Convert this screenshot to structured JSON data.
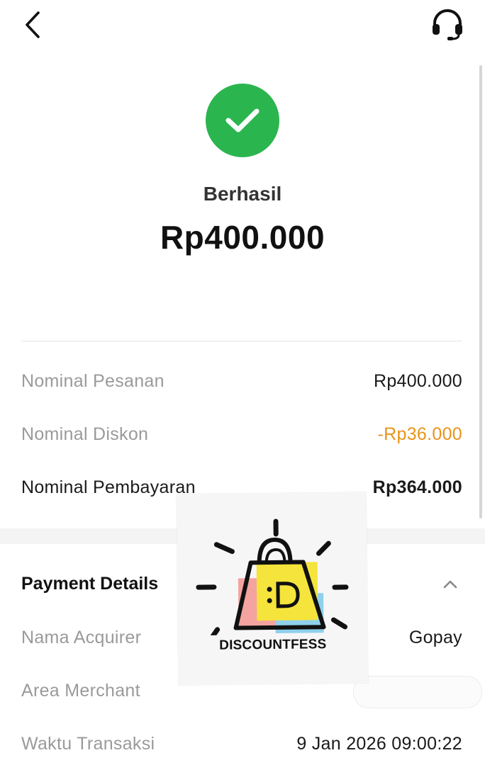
{
  "header": {
    "back_icon": "chevron-left-icon",
    "support_icon": "headset-icon"
  },
  "status": {
    "icon": "check-icon",
    "color": "#2bb54f",
    "text": "Berhasil",
    "amount": "Rp400.000"
  },
  "summary": [
    {
      "label": "Nominal Pesanan",
      "value": "Rp400.000"
    },
    {
      "label": "Nominal Diskon",
      "value": "-Rp36.000",
      "value_color": "#e8941a"
    },
    {
      "label": "Nominal Pembayaran",
      "value": "Rp364.000"
    }
  ],
  "payment_details": {
    "title": "Payment Details",
    "toggle_icon": "chevron-up-icon",
    "rows": [
      {
        "label": "Nama Acquirer",
        "value": "Gopay"
      },
      {
        "label": "Area Merchant",
        "value": ""
      },
      {
        "label": "Waktu Transaksi",
        "value": "9 Jan 2026 09:00:22"
      }
    ]
  },
  "watermark": {
    "text": "DISCOUNTFESS",
    "icon": "shopping-bag-logo-icon",
    "colors": {
      "yellow": "#f5e43b",
      "pink": "#f4a3a0",
      "blue": "#8fd0ec"
    }
  }
}
